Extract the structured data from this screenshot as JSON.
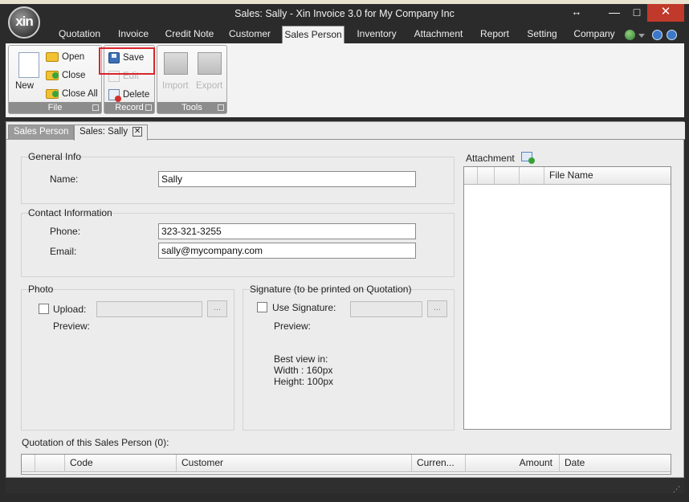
{
  "window": {
    "title": "Sales: Sally - Xin Invoice 3.0 for My Company Inc",
    "logo_text": "xin"
  },
  "menu": [
    {
      "id": "quotation",
      "label": "Quotation"
    },
    {
      "id": "invoice",
      "label": "Invoice"
    },
    {
      "id": "credit-note",
      "label": "Credit Note"
    },
    {
      "id": "customer",
      "label": "Customer"
    },
    {
      "id": "sales-person",
      "label": "Sales Person"
    },
    {
      "id": "inventory",
      "label": "Inventory"
    },
    {
      "id": "attachment",
      "label": "Attachment"
    },
    {
      "id": "report",
      "label": "Report"
    },
    {
      "id": "setting",
      "label": "Setting"
    },
    {
      "id": "company",
      "label": "Company"
    }
  ],
  "ribbon": {
    "file": {
      "label": "File",
      "new": "New",
      "open": "Open",
      "close": "Close",
      "close_all": "Close All"
    },
    "record": {
      "label": "Record",
      "save": "Save",
      "edit": "Edit",
      "delete": "Delete"
    },
    "tools": {
      "label": "Tools",
      "import": "Import",
      "export": "Export"
    }
  },
  "doc_tabs": [
    "Sales Person",
    "Sales: Sally"
  ],
  "general": {
    "title": "General Info",
    "name_label": "Name:",
    "name_value": "Sally"
  },
  "contact": {
    "title": "Contact Information",
    "phone_label": "Phone:",
    "phone_value": "323-321-3255",
    "email_label": "Email:",
    "email_value": "sally@mycompany.com"
  },
  "photo": {
    "title": "Photo",
    "upload_label": "Upload:",
    "preview_label": "Preview:",
    "browse": "..."
  },
  "signature": {
    "title": "Signature (to be printed on Quotation)",
    "use_label": "Use Signature:",
    "preview_label": "Preview:",
    "browse": "...",
    "hint_1": "Best view in:",
    "hint_2": "Width : 160px",
    "hint_3": "Height: 100px"
  },
  "attachment": {
    "title": "Attachment",
    "columns": [
      "",
      "",
      "",
      "",
      "File Name"
    ]
  },
  "quotations": {
    "title": "Quotation of this Sales Person (0):",
    "columns": [
      "",
      "",
      "Code",
      "Customer",
      "Curren...",
      "Amount",
      "Date"
    ]
  }
}
